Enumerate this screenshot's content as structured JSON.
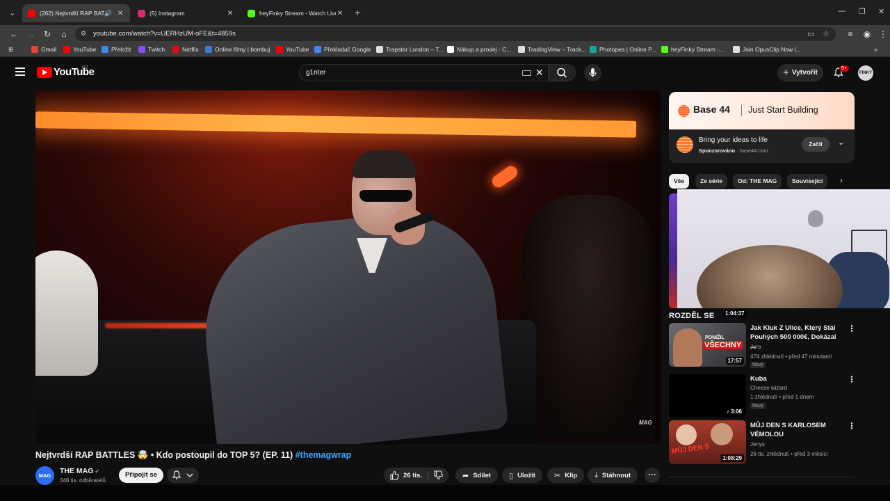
{
  "browser": {
    "tabs": [
      {
        "title": "(262) Nejtvrdší RAP BATTLES",
        "active": true,
        "color": "#ff0000"
      },
      {
        "title": "(5) Instagram",
        "active": false,
        "color": "#d62976"
      },
      {
        "title": "heyFinky Stream - Watch Live o",
        "active": false,
        "color": "#53fc18"
      }
    ],
    "url": "youtube.com/watch?v=UERHzUM-oFE&t=4859s",
    "bookmarks": [
      {
        "label": "Gmail",
        "color": "#ea4335"
      },
      {
        "label": "YouTube",
        "color": "#ff0000"
      },
      {
        "label": "Přeložit",
        "color": "#4285f4"
      },
      {
        "label": "Twitch",
        "color": "#9146ff"
      },
      {
        "label": "Netflix",
        "color": "#e50914"
      },
      {
        "label": "Online filmy | bombuj",
        "color": "#3a7bd5"
      },
      {
        "label": "YouTube",
        "color": "#ff0000"
      },
      {
        "label": "Překladač Google",
        "color": "#4285f4"
      },
      {
        "label": "Trapstar London – T...",
        "color": "#dddddd"
      },
      {
        "label": "Nákup a prodej - C...",
        "color": "#ffffff"
      },
      {
        "label": "TradingView – Track...",
        "color": "#dddddd"
      },
      {
        "label": "Photopea | Online P...",
        "color": "#18a497"
      },
      {
        "label": "heyFinky Stream -...",
        "color": "#53fc18"
      },
      {
        "label": "Join OpusClip Now |...",
        "color": "#dddddd"
      }
    ]
  },
  "yt": {
    "logo": "YouTube",
    "country": "CZ",
    "search_value": "g1nter",
    "create_label": "Vytvořit",
    "notif_count": "9+",
    "avatar_text": "FINKY"
  },
  "video": {
    "title": "Nejtvrdší RAP BATTLES 🤯 • Kdo postoupil do TOP 5? (EP. 11)",
    "hashtag": "#themagwrap",
    "watermark": "MAG",
    "channel": "THE MAG",
    "channel_avatar": "MAG",
    "subs": "348 tis. odběratelů",
    "join": "Připojit se",
    "likes": "26 tis.",
    "share": "Sdílet",
    "save": "Uložit",
    "clip": "Klip",
    "download": "Stáhnout"
  },
  "ad": {
    "brand": "Base 44",
    "tagline": "Just Start Building",
    "headline": "Bring your ideas to life",
    "sponsored": "Sponzorováno",
    "domain": "base44.com",
    "cta": "Začít"
  },
  "chips": [
    "Vše",
    "Ze série",
    "Od: THE MAG",
    "Související"
  ],
  "section_title": "ROZDĚL SE",
  "partial_duration": "1:04:37",
  "recs": [
    {
      "title": "Jak Kluk Z Ulice, Který Stál Pouhých 500 000€, Dokázal ...",
      "channel": "Jura",
      "meta": "474 zhlédnutí • před 47 minutami",
      "badge": "Nový",
      "duration": "17:57",
      "thumb_a": "PONIŽIL",
      "thumb_b": "VŠECHNY"
    },
    {
      "title": "Kuba",
      "channel": "Cheese wizard",
      "meta": "1 zhlédnutí • před 1 dnem",
      "badge": "Nový",
      "duration": "3:06"
    },
    {
      "title": "MŮJ DEN S KARLOSEM VÉMOLOU",
      "channel": "Jenys",
      "meta": "26 tis. zhlédnutí • před 3 měsíci",
      "duration": "1:08:29",
      "thumb_text": "MŮJ DEN S"
    }
  ]
}
